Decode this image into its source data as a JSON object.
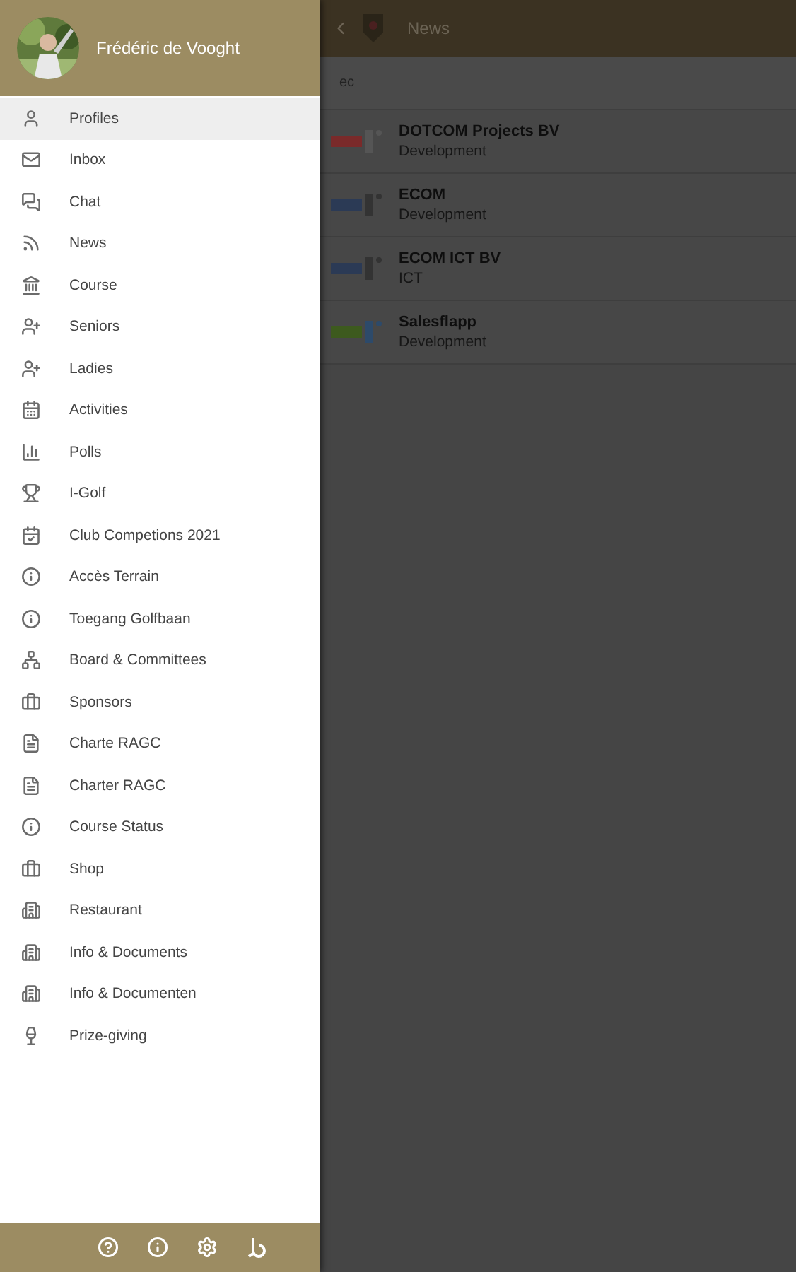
{
  "drawer": {
    "user_name": "Frédéric de Vooght",
    "items": [
      {
        "label": "Profiles",
        "selected": true
      },
      {
        "label": "Inbox",
        "selected": false
      },
      {
        "label": "Chat",
        "selected": false
      },
      {
        "label": "News",
        "selected": false
      },
      {
        "label": "Course",
        "selected": false
      },
      {
        "label": "Seniors",
        "selected": false
      },
      {
        "label": "Ladies",
        "selected": false
      },
      {
        "label": "Activities",
        "selected": false
      },
      {
        "label": "Polls",
        "selected": false
      },
      {
        "label": "I-Golf",
        "selected": false
      },
      {
        "label": "Club Competions 2021",
        "selected": false
      },
      {
        "label": "Accès Terrain",
        "selected": false
      },
      {
        "label": "Toegang Golfbaan",
        "selected": false
      },
      {
        "label": "Board & Committees",
        "selected": false
      },
      {
        "label": "Sponsors",
        "selected": false
      },
      {
        "label": "Charte RAGC",
        "selected": false
      },
      {
        "label": "Charter RAGC",
        "selected": false
      },
      {
        "label": "Course Status",
        "selected": false
      },
      {
        "label": "Shop",
        "selected": false
      },
      {
        "label": "Restaurant",
        "selected": false
      },
      {
        "label": "Info & Documents",
        "selected": false
      },
      {
        "label": "Info & Documenten",
        "selected": false
      },
      {
        "label": "Prize-giving",
        "selected": false
      }
    ]
  },
  "page": {
    "title": "News",
    "search": {
      "value": "ec"
    },
    "results": [
      {
        "name": "DOTCOM Projects BV",
        "category": "Development"
      },
      {
        "name": "ECOM",
        "category": "Development"
      },
      {
        "name": "ECOM ICT BV",
        "category": "ICT"
      },
      {
        "name": "Salesflapp",
        "category": "Development"
      }
    ]
  }
}
